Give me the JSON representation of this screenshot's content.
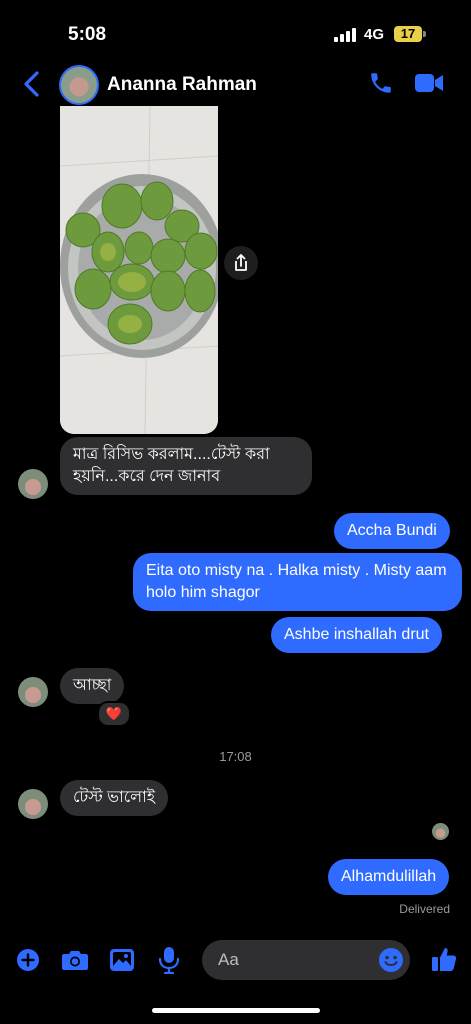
{
  "status_bar": {
    "time": "5:08",
    "network": "4G",
    "battery": "17"
  },
  "header": {
    "contact_name": "Ananna Rahman"
  },
  "messages": {
    "in_1": "মাত্র রিসিভ করলাম....টেস্ট করা হয়নি...করে দেন জানাব",
    "out_1": "Accha Bundi",
    "out_2": "Eita oto misty na . Halka misty . Misty aam holo him shagor",
    "out_3": "Ashbe inshallah drut",
    "in_2": "আচ্ছা",
    "in_2_reaction": "❤️",
    "timestamp": "17:08",
    "in_3": "টেস্ট ভালোই",
    "out_4": "Alhamdulillah",
    "delivery_status": "Delivered"
  },
  "composer": {
    "placeholder": "Aa"
  },
  "colors": {
    "accent": "#2f6bff",
    "incoming_bubble": "#2f2f31",
    "background": "#000000"
  }
}
